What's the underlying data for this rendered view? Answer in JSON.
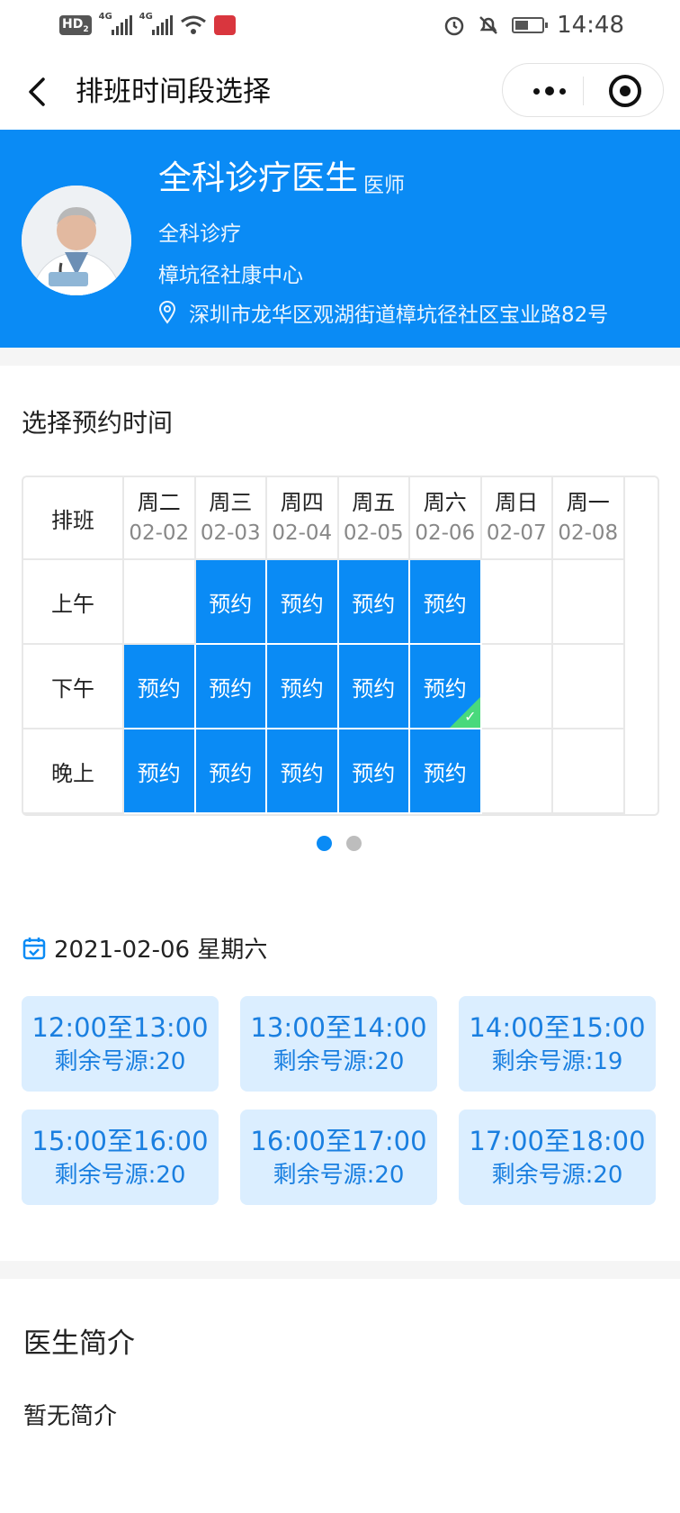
{
  "status_bar": {
    "hd_label": "HD",
    "hd_sub": "2",
    "net1": "4G",
    "net2": "4G",
    "time": "14:48"
  },
  "nav": {
    "title": "排班时间段选择"
  },
  "doctor": {
    "name": "全科诊疗医生",
    "title": "医师",
    "department": "全科诊疗",
    "hospital": "樟坑径社康中心",
    "address": "深圳市龙华区观湖街道樟坑径社区宝业路82号"
  },
  "schedule": {
    "section_title": "选择预约时间",
    "corner_label": "排班",
    "days": [
      {
        "weekday": "周二",
        "date": "02-02"
      },
      {
        "weekday": "周三",
        "date": "02-03"
      },
      {
        "weekday": "周四",
        "date": "02-04"
      },
      {
        "weekday": "周五",
        "date": "02-05"
      },
      {
        "weekday": "周六",
        "date": "02-06"
      },
      {
        "weekday": "周日",
        "date": "02-07"
      },
      {
        "weekday": "周一",
        "date": "02-08"
      }
    ],
    "periods": [
      "上午",
      "下午",
      "晚上"
    ],
    "book_label": "预约",
    "availability": [
      [
        false,
        true,
        true,
        true,
        true,
        false,
        false
      ],
      [
        true,
        true,
        true,
        true,
        true,
        false,
        false
      ],
      [
        true,
        true,
        true,
        true,
        true,
        false,
        false
      ]
    ],
    "selected": {
      "period_index": 1,
      "day_index": 4
    },
    "pager": {
      "pages": 2,
      "current": 1
    }
  },
  "selected_date": "2021-02-06 星期六",
  "slots": [
    {
      "time": "12:00至13:00",
      "remaining": "剩余号源:20"
    },
    {
      "time": "13:00至14:00",
      "remaining": "剩余号源:20"
    },
    {
      "time": "14:00至15:00",
      "remaining": "剩余号源:19"
    },
    {
      "time": "15:00至16:00",
      "remaining": "剩余号源:20"
    },
    {
      "time": "16:00至17:00",
      "remaining": "剩余号源:20"
    },
    {
      "time": "17:00至18:00",
      "remaining": "剩余号源:20"
    }
  ],
  "intro": {
    "title": "医生简介",
    "body": "暂无简介"
  },
  "colors": {
    "primary": "#0a8bf5",
    "slot_bg": "#dbeeff",
    "slot_text": "#1a7fe0",
    "check": "#49d97c"
  }
}
